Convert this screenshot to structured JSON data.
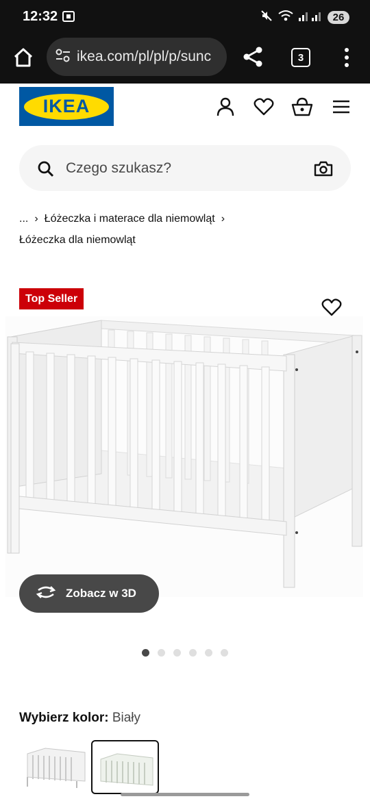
{
  "status": {
    "time": "12:32",
    "battery": "26"
  },
  "browser": {
    "url": "ikea.com/pl/pl/p/sunc",
    "tab_count": "3"
  },
  "brand": {
    "logo_text": "IKEA",
    "blue": "#0058a3",
    "yellow": "#ffdb00"
  },
  "search": {
    "placeholder": "Czego szukasz?"
  },
  "breadcrumb": {
    "items": [
      "...",
      "Łóżeczka i materace dla niemowląt",
      "Łóżeczka dla niemowląt"
    ],
    "separator": "›"
  },
  "product": {
    "badge": "Top Seller",
    "badge_color": "#cc0008",
    "view3d_label": "Zobacz w 3D",
    "gallery": {
      "count": 6,
      "active_index": 0
    }
  },
  "color_picker": {
    "label": "Wybierz kolor:",
    "selected": "Biały",
    "swatches": [
      "white-crib",
      "white-crib-alt"
    ],
    "selected_index": 1
  },
  "icons": {
    "header": [
      "user-icon",
      "heart-icon",
      "basket-icon",
      "hamburger-menu-icon"
    ],
    "browser": [
      "home-icon",
      "share-icon",
      "tabs-icon",
      "kebab-menu-icon"
    ]
  }
}
